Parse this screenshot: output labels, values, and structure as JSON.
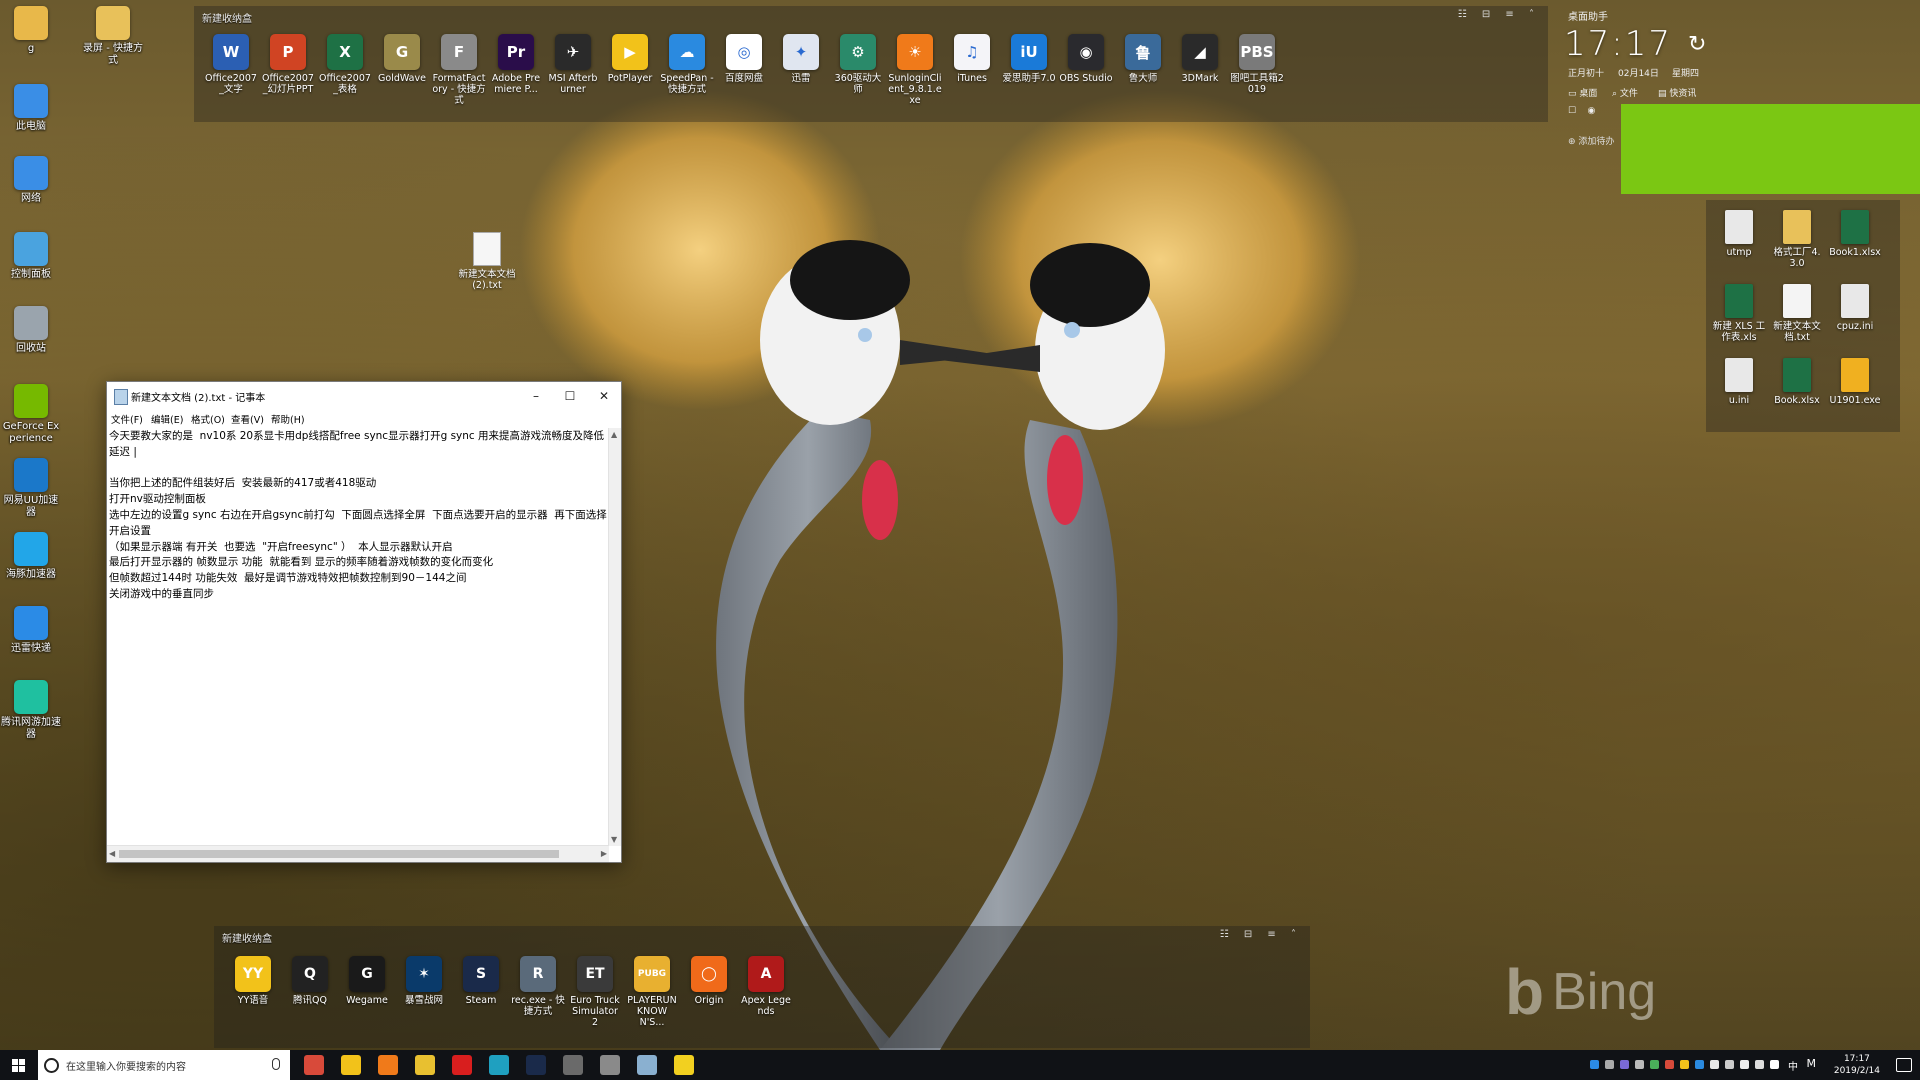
{
  "desktop": {
    "left_icons": [
      {
        "label": "g",
        "icon": "folder-icon",
        "color": "#e8b84a"
      },
      {
        "label": "录屏 - 快捷方式",
        "icon": "folder-icon",
        "color": "#e8c15a"
      },
      {
        "label": "此电脑",
        "icon": "computer-icon",
        "color": "#3a8ee6"
      },
      {
        "label": "网络",
        "icon": "network-icon",
        "color": "#3a8ee6"
      },
      {
        "label": "控制面板",
        "icon": "control-panel-icon",
        "color": "#4aa3df"
      },
      {
        "label": "回收站",
        "icon": "recycle-bin-icon",
        "color": "#9aa4ad"
      },
      {
        "label": "GeForce Experience",
        "icon": "geforce-icon",
        "color": "#76b900"
      },
      {
        "label": "网易UU加速器",
        "icon": "uu-accelerator-icon",
        "color": "#1b78c9"
      },
      {
        "label": "海豚加速器",
        "icon": "dolphin-accelerator-icon",
        "color": "#22a6e8"
      },
      {
        "label": "迅雷快递",
        "icon": "thunder-icon",
        "color": "#2b8be6"
      },
      {
        "label": "腾讯网游加速器",
        "icon": "tencent-accelerator-icon",
        "color": "#1fc0a0"
      }
    ],
    "file_on_wallpaper": {
      "label": "新建文本文档 (2).txt",
      "icon": "text-file-icon"
    },
    "bing_watermark": "Bing"
  },
  "top_fence": {
    "title": "新建收纳盒",
    "items": [
      {
        "label": "Office2007_文字",
        "icon": "word-icon",
        "color": "#2b5fb3",
        "glyph": "W"
      },
      {
        "label": "Office2007_幻灯片PPT",
        "icon": "ppt-icon",
        "color": "#d04423",
        "glyph": "P"
      },
      {
        "label": "Office2007_表格",
        "icon": "excel-icon",
        "color": "#1e7145",
        "glyph": "X"
      },
      {
        "label": "GoldWave",
        "icon": "goldwave-icon",
        "color": "#9a8a4a",
        "glyph": "G"
      },
      {
        "label": "FormatFactory - 快捷方式",
        "icon": "format-factory-icon",
        "color": "#8a8a8a",
        "glyph": "F"
      },
      {
        "label": "Adobe Premiere P...",
        "icon": "premiere-icon",
        "color": "#2a0d4a",
        "glyph": "Pr"
      },
      {
        "label": "MSI Afterburner",
        "icon": "afterburner-icon",
        "color": "#2a2a2a",
        "glyph": "✈"
      },
      {
        "label": "PotPlayer",
        "icon": "potplayer-icon",
        "color": "#f2c21a",
        "glyph": "▶"
      },
      {
        "label": "SpeedPan - 快捷方式",
        "icon": "speedpan-icon",
        "color": "#2a8ae0",
        "glyph": "☁"
      },
      {
        "label": "百度网盘",
        "icon": "baidu-pan-icon",
        "color": "#ffffff",
        "glyph": "◎"
      },
      {
        "label": "迅雷",
        "icon": "thunder-icon",
        "color": "#e0e6f0",
        "glyph": "✦"
      },
      {
        "label": "360驱动大师",
        "icon": "driver-master-icon",
        "color": "#2a8a6a",
        "glyph": "⚙"
      },
      {
        "label": "SunloginClient_9.8.1.exe",
        "icon": "sunlogin-icon",
        "color": "#f07a1a",
        "glyph": "☀"
      },
      {
        "label": "iTunes",
        "icon": "itunes-icon",
        "color": "#f4f4f8",
        "glyph": "♫"
      },
      {
        "label": "爱思助手7.0",
        "icon": "i4-icon",
        "color": "#1a7ad8",
        "glyph": "iU"
      },
      {
        "label": "OBS Studio",
        "icon": "obs-icon",
        "color": "#2a2a2e",
        "glyph": "◉"
      },
      {
        "label": "鲁大师",
        "icon": "ludashi-icon",
        "color": "#3a6a9a",
        "glyph": "鲁"
      },
      {
        "label": "3DMark",
        "icon": "3dmark-icon",
        "color": "#2a2a2a",
        "glyph": "◢"
      },
      {
        "label": "图吧工具箱2019",
        "icon": "tuba-toolbox-icon",
        "color": "#7a7a7a",
        "glyph": "PBS"
      }
    ]
  },
  "bottom_fence": {
    "title": "新建收纳盒",
    "items": [
      {
        "label": "YY语音",
        "icon": "yy-icon",
        "color": "#f2c21a",
        "glyph": "YY"
      },
      {
        "label": "腾讯QQ",
        "icon": "qq-icon",
        "color": "#222222",
        "glyph": "Q"
      },
      {
        "label": "Wegame",
        "icon": "wegame-icon",
        "color": "#1a1a1a",
        "glyph": "G"
      },
      {
        "label": "暴雪战网",
        "icon": "battlenet-icon",
        "color": "#0a3a6a",
        "glyph": "✶"
      },
      {
        "label": "Steam",
        "icon": "steam-icon",
        "color": "#1a2a4a",
        "glyph": "S"
      },
      {
        "label": "rec.exe - 快捷方式",
        "icon": "rec-icon",
        "color": "#5a6a7a",
        "glyph": "R"
      },
      {
        "label": "Euro Truck Simulator 2",
        "icon": "ets2-icon",
        "color": "#3a3a3a",
        "glyph": "ET"
      },
      {
        "label": "PLAYERUNKNOWN'S...",
        "icon": "pubg-icon",
        "color": "#e8b030",
        "glyph": "PUBG"
      },
      {
        "label": "Origin",
        "icon": "origin-icon",
        "color": "#f06a1a",
        "glyph": "◯"
      },
      {
        "label": "Apex Legends",
        "icon": "apex-icon",
        "color": "#b01a1a",
        "glyph": "A"
      }
    ]
  },
  "clock_widget": {
    "title": "桌面助手",
    "time": "17:17",
    "lunar": "正月初十",
    "date": "02月14日",
    "weekday": "星期四",
    "links": [
      "桌面",
      "文件",
      "快资讯"
    ],
    "add_label": "添加待办"
  },
  "right_files": [
    {
      "label": "utmp",
      "icon": "file-icon",
      "color": "#e8e8e8"
    },
    {
      "label": "格式工厂4.3.0",
      "icon": "folder-icon",
      "color": "#e8c15a"
    },
    {
      "label": "Book1.xlsx",
      "icon": "excel-file-icon",
      "color": "#1e7145"
    },
    {
      "label": "新建 XLS 工作表.xls",
      "icon": "excel-file-icon",
      "color": "#1e7145"
    },
    {
      "label": "新建文本文档.txt",
      "icon": "text-file-icon",
      "color": "#f4f4f4"
    },
    {
      "label": "cpuz.ini",
      "icon": "ini-file-icon",
      "color": "#e8e8e8"
    },
    {
      "label": "u.ini",
      "icon": "ini-file-icon",
      "color": "#e8e8e8"
    },
    {
      "label": "Book.xlsx",
      "icon": "excel-file-icon",
      "color": "#1e7145"
    },
    {
      "label": "U1901.exe",
      "icon": "exe-icon",
      "color": "#f0b020"
    }
  ],
  "notepad": {
    "title": "新建文本文档 (2).txt - 记事本",
    "window_controls": {
      "minimize": "–",
      "maximize": "☐",
      "close": "✕"
    },
    "menu": [
      "文件(F)",
      "编辑(E)",
      "格式(O)",
      "查看(V)",
      "帮助(H)"
    ],
    "content": "今天要教大家的是  nv10系 20系显卡用dp线搭配free sync显示器打开g sync 用来提高游戏流畅度及降低延迟 |\n\n当你把上述的配件组装好后  安装最新的417或者418驱动\n打开nv驱动控制面板\n选中左边的设置g sync 右边在开启gsync前打勾  下面圆点选择全屏  下面点选要开启的显示器  再下面选择开启设置\n（如果显示器端 有开关  也要选  \"开启freesync\" ）  本人显示器默认开启\n最后打开显示器的 帧数显示 功能  就能看到 显示的频率随着游戏帧数的变化而变化\n但帧数超过144时 功能失效  最好是调节游戏特效把帧数控制到90－144之间\n关闭游戏中的垂直同步"
  },
  "taskbar": {
    "search_placeholder": "在这里输入你要搜索的内容",
    "pinned": [
      {
        "name": "taskbar-app-1",
        "icon": "app-red-icon",
        "color": "#d84a3a"
      },
      {
        "name": "taskbar-explorer",
        "icon": "file-explorer-icon",
        "color": "#f2c21a"
      },
      {
        "name": "taskbar-firefox",
        "icon": "firefox-icon",
        "color": "#f07a1a"
      },
      {
        "name": "taskbar-app-4",
        "icon": "app-yellow-icon",
        "color": "#e8c030"
      },
      {
        "name": "taskbar-netease-music",
        "icon": "netease-music-icon",
        "color": "#d81e1e"
      },
      {
        "name": "taskbar-accelerator",
        "icon": "accelerator-icon",
        "color": "#1fa0c0"
      },
      {
        "name": "taskbar-steam",
        "icon": "steam-icon",
        "color": "#1a2a4a"
      },
      {
        "name": "taskbar-app-8",
        "icon": "app-gray-icon",
        "color": "#6a6a6a"
      },
      {
        "name": "taskbar-app-9",
        "icon": "app-gray-icon",
        "color": "#8a8a8a"
      },
      {
        "name": "taskbar-notepad",
        "icon": "notepad-icon",
        "color": "#8ab0d0"
      },
      {
        "name": "taskbar-sticky",
        "icon": "sticky-notes-icon",
        "color": "#f2d020"
      }
    ],
    "tray_ime": "中",
    "tray_time": "17:17",
    "tray_date": "2019/2/14"
  }
}
